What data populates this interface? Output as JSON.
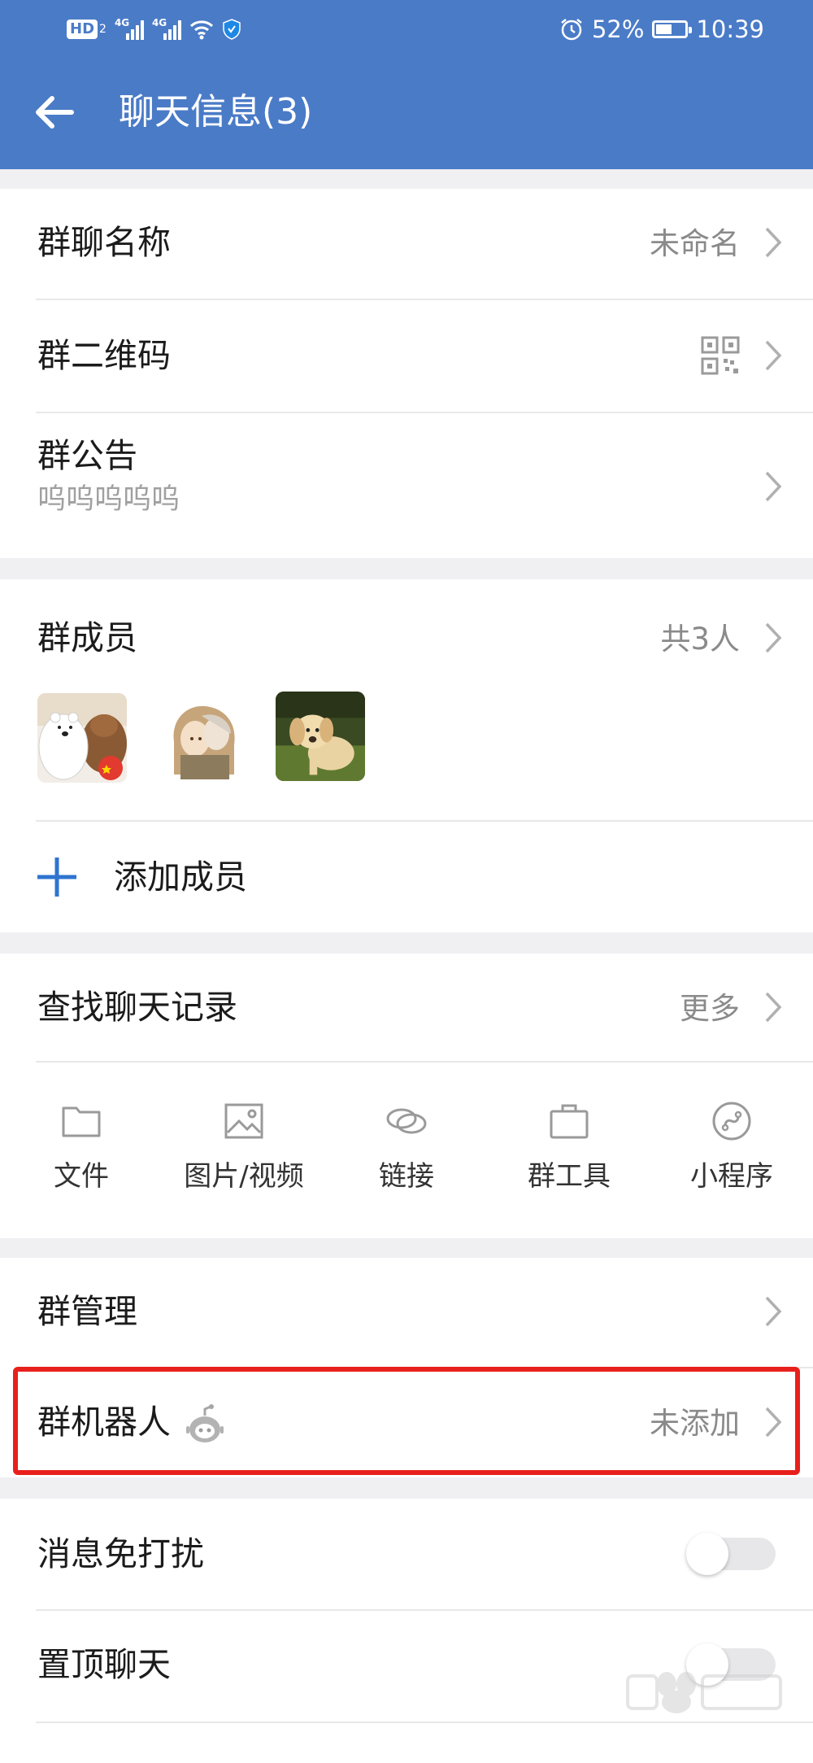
{
  "status_bar": {
    "left_badges": [
      "HD",
      "2",
      "4G",
      "4G"
    ],
    "battery": "52%",
    "battery_level": 0.52,
    "time": "10:39"
  },
  "header": {
    "title": "聊天信息(3)"
  },
  "info": {
    "group_name": {
      "label": "群聊名称",
      "value": "未命名"
    },
    "qr_code": {
      "label": "群二维码"
    },
    "announcement": {
      "label": "群公告",
      "content": "呜呜呜呜呜"
    }
  },
  "members": {
    "label": "群成员",
    "count": "共3人",
    "add_label": "添加成员"
  },
  "history": {
    "label": "查找聊天记录",
    "more": "更多",
    "shortcuts": [
      {
        "label": "文件",
        "icon": "folder-icon"
      },
      {
        "label": "图片/视频",
        "icon": "image-icon"
      },
      {
        "label": "链接",
        "icon": "link-icon"
      },
      {
        "label": "群工具",
        "icon": "briefcase-icon"
      },
      {
        "label": "小程序",
        "icon": "mini-program-icon"
      }
    ]
  },
  "manage": {
    "group_manage": {
      "label": "群管理"
    },
    "group_robot": {
      "label": "群机器人",
      "value": "未添加"
    }
  },
  "settings": {
    "mute": {
      "label": "消息免打扰",
      "on": false
    },
    "pin": {
      "label": "置顶聊天",
      "on": false
    }
  },
  "colors": {
    "header": "#4a7bc7",
    "accent": "#2f74d0",
    "highlight": "#e8201c"
  }
}
